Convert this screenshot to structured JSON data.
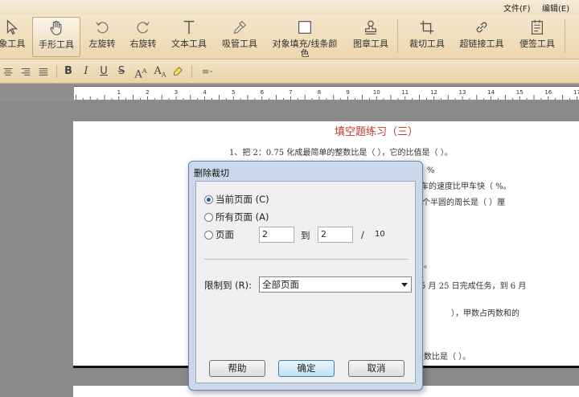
{
  "menubar": {
    "file": "文件(F)",
    "edit": "编辑(E)"
  },
  "ribbon": {
    "tools": [
      {
        "label": "象工具"
      },
      {
        "label": "手形工具"
      },
      {
        "label": "左旋转"
      },
      {
        "label": "右旋转"
      },
      {
        "label": "文本工具"
      },
      {
        "label": "吸管工具"
      },
      {
        "label": "对象填充/线条颜",
        "label2": "色"
      },
      {
        "label": "图章工具"
      },
      {
        "label": "裁切工具"
      },
      {
        "label": "超链接工具"
      },
      {
        "label": "便签工具"
      }
    ]
  },
  "formatbar": {
    "bold": "B",
    "italic": "I",
    "underline": "U",
    "strike": "S",
    "sup": "A",
    "sub": "A"
  },
  "ruler": {
    "numbers": [
      "1",
      "2",
      "3",
      "4",
      "5",
      "6",
      "7",
      "8",
      "9",
      "10",
      "11",
      "12",
      "13",
      "14",
      "15",
      "16",
      "17"
    ]
  },
  "document": {
    "title": "填空题练习（三）",
    "lines": [
      "1、把 2：0.75 化成最简单的整数比是（    ），它的比值是（    ）。",
      "）%",
      "车的速度比甲车快（    %。",
      "个半圆的周长是（      ）厘",
      "。",
      "5 月 25 日完成任务，到 6 月",
      "），甲数占丙数和的",
      "数比是（            ）。"
    ]
  },
  "dialog": {
    "title": "删除裁切",
    "radio_current": "当前页面 (C)",
    "radio_all": "所有页面 (A)",
    "radio_pages": "页面",
    "from_value": "2",
    "to_label": "到",
    "to_value": "2",
    "slash": "/",
    "total_pages": "10",
    "limit_label": "限制到 (R):",
    "limit_value": "全部页面",
    "help_button": "帮助",
    "ok_button": "确定",
    "cancel_button": "取消"
  }
}
